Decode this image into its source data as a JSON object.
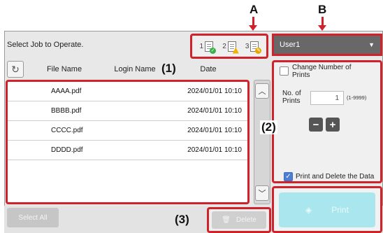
{
  "callouts": {
    "a": "A",
    "b": "B",
    "one": "(1)",
    "two": "(2)",
    "three": "(3)"
  },
  "instruction": "Select Job to Operate.",
  "job_counts": [
    {
      "number": "1",
      "status": "check-badge"
    },
    {
      "number": "2",
      "status": "warning-badge"
    },
    {
      "number": "3",
      "status": "edit-badge"
    }
  ],
  "user_select": {
    "value": "User1"
  },
  "columns": {
    "file_name": "File Name",
    "login_name": "Login Name",
    "date": "Date"
  },
  "jobs": [
    {
      "file": "AAAA.pdf",
      "date": "2024/01/01 10:10"
    },
    {
      "file": "BBBB.pdf",
      "date": "2024/01/01 10:10"
    },
    {
      "file": "CCCC.pdf",
      "date": "2024/01/01 10:10"
    },
    {
      "file": "DDDD.pdf",
      "date": "2024/01/01 10:10"
    }
  ],
  "settings": {
    "change_number_label": "Change Number of Prints",
    "no_of_prints_label": "No. of Prints",
    "prints_value": "1",
    "prints_range": "(1-9999)",
    "print_and_delete_label": "Print and Delete the Data",
    "print_and_delete_checked": true
  },
  "buttons": {
    "select_all": "Select All",
    "delete": "Delete",
    "print": "Print"
  },
  "colors": {
    "highlight": "#d0222a",
    "print_button": "#a9e6ee",
    "user_select": "#686868"
  }
}
